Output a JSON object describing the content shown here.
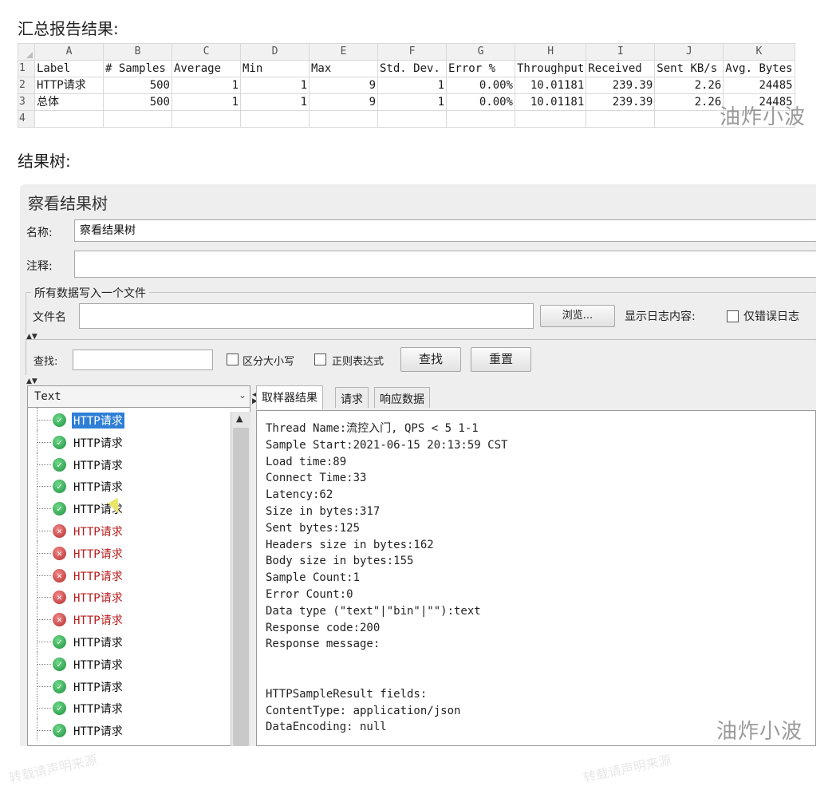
{
  "headings": {
    "summary": "汇总报告结果:",
    "tree": "结果树:"
  },
  "sheet": {
    "columns": [
      "A",
      "B",
      "C",
      "D",
      "E",
      "F",
      "G",
      "H",
      "I",
      "J",
      "K"
    ],
    "headers": [
      "Label",
      "# Samples",
      "Average",
      "Min",
      "Max",
      "Std. Dev.",
      "Error %",
      "Throughput",
      "Received",
      "Sent KB/s",
      "Avg. Bytes"
    ],
    "rows": [
      [
        "HTTP请求",
        "500",
        "1",
        "1",
        "9",
        "1",
        "0.00%",
        "10.01181",
        "239.39",
        "2.26",
        "24485"
      ],
      [
        "总体",
        "500",
        "1",
        "1",
        "9",
        "1",
        "0.00%",
        "10.01181",
        "239.39",
        "2.26",
        "24485"
      ]
    ],
    "row_numbers": [
      "1",
      "2",
      "3",
      "4"
    ]
  },
  "panel": {
    "title": "察看结果树",
    "name_label": "名称:",
    "name_value": "察看结果树",
    "comment_label": "注释:",
    "comment_value": "",
    "fileset_label": "所有数据写入一个文件",
    "filename_label": "文件名",
    "filename_value": "",
    "browse_label": "浏览...",
    "log_label": "显示日志内容:",
    "errors_only_label": "仅错误日志",
    "search_label": "查找:",
    "search_value": "",
    "case_label": "区分大小写",
    "regex_label": "正则表达式",
    "find_button": "查找",
    "reset_button": "重置",
    "renderer": "Text",
    "tabs": [
      "取样器结果",
      "请求",
      "响应数据"
    ],
    "tree_items": [
      {
        "label": "HTTP请求",
        "status": "ok",
        "selected": true
      },
      {
        "label": "HTTP请求",
        "status": "ok"
      },
      {
        "label": "HTTP请求",
        "status": "ok"
      },
      {
        "label": "HTTP请求",
        "status": "ok"
      },
      {
        "label": "HTTP请求",
        "status": "ok"
      },
      {
        "label": "HTTP请求",
        "status": "error"
      },
      {
        "label": "HTTP请求",
        "status": "error"
      },
      {
        "label": "HTTP请求",
        "status": "error"
      },
      {
        "label": "HTTP请求",
        "status": "error"
      },
      {
        "label": "HTTP请求",
        "status": "error"
      },
      {
        "label": "HTTP请求",
        "status": "ok"
      },
      {
        "label": "HTTP请求",
        "status": "ok"
      },
      {
        "label": "HTTP请求",
        "status": "ok"
      },
      {
        "label": "HTTP请求",
        "status": "ok"
      },
      {
        "label": "HTTP请求",
        "status": "ok"
      }
    ],
    "result_lines": [
      "Thread Name:流控入门, QPS < 5 1-1",
      "Sample Start:2021-06-15 20:13:59 CST",
      "Load time:89",
      "Connect Time:33",
      "Latency:62",
      "Size in bytes:317",
      "Sent bytes:125",
      "Headers size in bytes:162",
      "Body size in bytes:155",
      "Sample Count:1",
      "Error Count:0",
      "Data type (\"text\"|\"bin\"|\"\"):text",
      "Response code:200",
      "Response message:",
      "",
      "",
      "HTTPSampleResult fields:",
      "ContentType: application/json",
      "DataEncoding: null"
    ]
  },
  "watermarks": {
    "brand": "油炸小波",
    "faint": "转载请声明来源"
  },
  "colors": {
    "ok": "#1d8f3c",
    "error": "#b71c1c",
    "selection": "#2f7fd6"
  }
}
